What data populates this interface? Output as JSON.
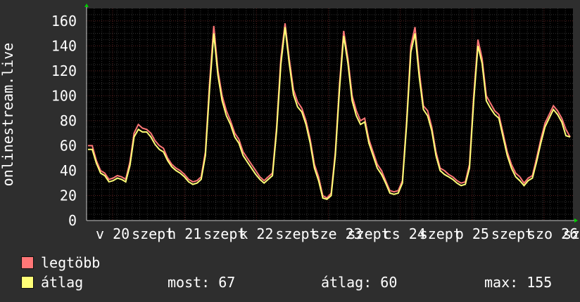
{
  "chart_data": {
    "type": "line",
    "ylabel": "onlinestream.live",
    "ylim": [
      0,
      170
    ],
    "yticks": [
      0,
      20,
      40,
      60,
      80,
      100,
      120,
      140,
      160
    ],
    "x_tick_labels": [
      "v 20",
      "szept",
      "h 21",
      "szept",
      "k 22",
      "szept",
      "sze 23",
      "szept",
      "cs 24",
      "szept",
      "p 25",
      "szept",
      "szo 26",
      "sze"
    ],
    "grid": true,
    "colors": {
      "max": "#ff7777",
      "avg": "#ffff77",
      "background": "#000000",
      "grid_major": "#5a2020",
      "grid_minor": "#333333"
    },
    "series": [
      {
        "name": "legtöbb",
        "values": [
          60,
          60,
          48,
          40,
          38,
          33,
          34,
          36,
          35,
          33,
          47,
          70,
          77,
          74,
          73,
          70,
          64,
          60,
          58,
          50,
          45,
          42,
          40,
          37,
          33,
          31,
          32,
          35,
          55,
          110,
          156,
          120,
          100,
          88,
          80,
          70,
          65,
          55,
          50,
          45,
          40,
          35,
          32,
          35,
          38,
          75,
          130,
          158,
          130,
          105,
          95,
          90,
          80,
          65,
          45,
          35,
          20,
          18,
          22,
          55,
          110,
          152,
          130,
          100,
          88,
          80,
          82,
          65,
          55,
          45,
          40,
          32,
          24,
          23,
          24,
          32,
          80,
          140,
          155,
          120,
          92,
          88,
          75,
          55,
          42,
          40,
          37,
          35,
          32,
          30,
          31,
          45,
          100,
          145,
          130,
          100,
          94,
          88,
          85,
          70,
          55,
          45,
          38,
          35,
          30,
          34,
          36,
          50,
          65,
          78,
          85,
          92,
          88,
          82,
          73,
          67
        ],
        "values_note": "hourly samples, ~116 points across the window"
      },
      {
        "name": "átlag",
        "values": [
          57,
          57,
          46,
          38,
          36,
          31,
          32,
          34,
          33,
          31,
          44,
          67,
          73,
          71,
          71,
          67,
          61,
          57,
          55,
          48,
          43,
          40,
          38,
          35,
          31,
          29,
          30,
          33,
          52,
          105,
          150,
          116,
          96,
          84,
          77,
          67,
          62,
          52,
          47,
          42,
          37,
          33,
          30,
          33,
          36,
          72,
          125,
          155,
          126,
          101,
          91,
          87,
          77,
          62,
          42,
          32,
          18,
          17,
          20,
          52,
          106,
          148,
          126,
          96,
          84,
          77,
          79,
          62,
          52,
          42,
          37,
          30,
          22,
          21,
          22,
          30,
          77,
          135,
          150,
          115,
          89,
          84,
          72,
          52,
          40,
          37,
          35,
          33,
          30,
          28,
          29,
          42,
          96,
          140,
          126,
          96,
          90,
          85,
          82,
          67,
          52,
          42,
          35,
          32,
          28,
          32,
          34,
          47,
          62,
          75,
          82,
          89,
          85,
          79,
          68,
          67
        ]
      }
    ]
  },
  "legend": {
    "max_label": "legtöbb",
    "avg_label": "átlag"
  },
  "stats": {
    "now": "most: 67",
    "avg": "átlag: 60",
    "max": "max: 155"
  }
}
